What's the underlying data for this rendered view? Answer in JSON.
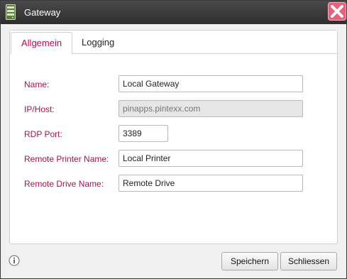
{
  "window": {
    "title": "Gateway"
  },
  "tabs": [
    {
      "label": "Allgemein",
      "active": true
    },
    {
      "label": "Logging",
      "active": false
    }
  ],
  "form": {
    "name": {
      "label": "Name:",
      "value": "Local Gateway"
    },
    "host": {
      "label": "IP/Host:",
      "value": "pinapps.pintexx.com",
      "disabled": true
    },
    "rdp_port": {
      "label": "RDP Port:",
      "value": "3389"
    },
    "remote_printer": {
      "label": "Remote Printer Name:",
      "value": "Local Printer"
    },
    "remote_drive": {
      "label": "Remote Drive Name:",
      "value": "Remote Drive"
    }
  },
  "footer": {
    "info_icon": "info-icon",
    "save_label": "Speichern",
    "close_label": "Schliessen"
  },
  "colors": {
    "accent": "#b0104e",
    "titlebar": "#3a3a3a",
    "close_button": "#e8607a"
  }
}
